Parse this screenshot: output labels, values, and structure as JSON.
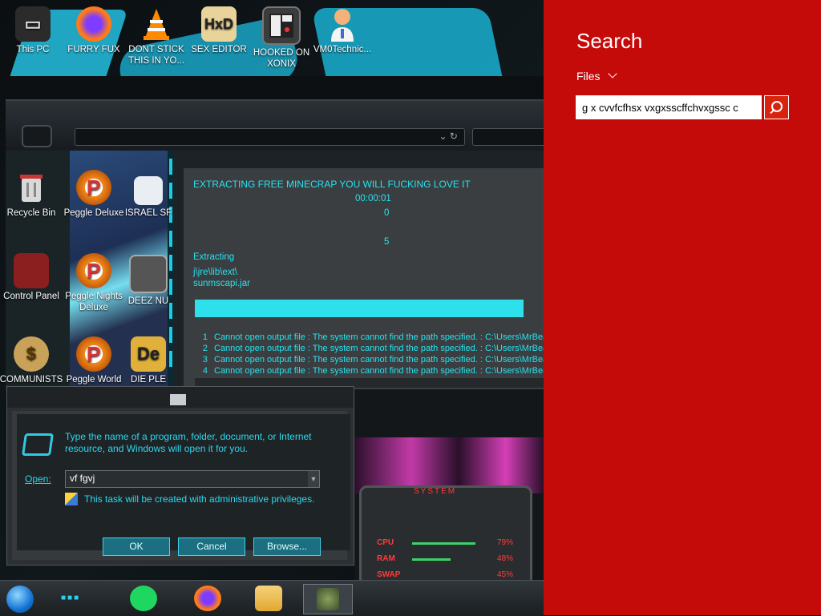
{
  "desktop_top_icons": [
    {
      "label": "This PC",
      "icon": "computer-icon",
      "color": "#444"
    },
    {
      "label": "FURRY FUX",
      "icon": "firefox-icon",
      "color": "#ff7a1a"
    },
    {
      "label": "DONT STICK THIS IN YO...",
      "icon": "vlc-cone-icon",
      "color": "#ff8a00"
    },
    {
      "label": "SEX EDITOR",
      "icon": "hxd-icon",
      "color": "#e8d39a"
    },
    {
      "label": "HOOKED ON XONIX",
      "icon": "xonix-icon",
      "color": "#3c3c3c"
    },
    {
      "label": "VM0Technic...",
      "icon": "doctor-icon",
      "color": "#f0f0f0"
    }
  ],
  "desktop_side_icons": [
    {
      "label": "Recycle Bin",
      "icon": "recycle-bin-icon",
      "color": "#cfcfcf"
    },
    {
      "label": "Peggle Deluxe",
      "icon": "peggle-icon",
      "color": "#f08a1a"
    },
    {
      "label": "ISRAEL SF",
      "icon": "israel-icon",
      "color": "#ddd"
    },
    {
      "label": "Control Panel",
      "icon": "control-panel-icon",
      "color": "#c44"
    },
    {
      "label": "Peggle Nights Deluxe",
      "icon": "peggle-icon",
      "color": "#f08a1a"
    },
    {
      "label": "DEEZ NU",
      "icon": "folder-stack-icon",
      "color": "#888"
    },
    {
      "label": "COMMUNISTS",
      "icon": "money-bag-icon",
      "color": "#c9a25a"
    },
    {
      "label": "Peggle World",
      "icon": "peggle-icon",
      "color": "#f08a1a"
    },
    {
      "label": "DIE PLE",
      "icon": "de-icon",
      "color": "#e0b03a"
    }
  ],
  "installer": {
    "heading": "EXTRACTING FREE MINECRAP YOU WILL FUCKING LOVE IT",
    "elapsed": "00:00:01",
    "count1": "0",
    "count2": "5",
    "status_label": "Extracting",
    "path_line1": "j\\jre\\lib\\ext\\",
    "path_line2": "sunmscapi.jar",
    "progress_fraction": 1.0,
    "log": [
      {
        "n": "1",
        "text": "Cannot open output file : The system cannot find the path specified. : C:\\Users\\MrBeast"
      },
      {
        "n": "2",
        "text": "Cannot open output file : The system cannot find the path specified. : C:\\Users\\MrBeast"
      },
      {
        "n": "3",
        "text": "Cannot open output file : The system cannot find the path specified. : C:\\Users\\MrBeast"
      },
      {
        "n": "4",
        "text": "Cannot open output file : The system cannot find the path specified. : C:\\Users\\MrBeast"
      }
    ]
  },
  "sysmon": {
    "title": "SYSTEM",
    "cpu_label": "CPU",
    "cpu_pct": "79%",
    "cpu_fraction": 0.79,
    "ram_label": "RAM",
    "ram_pct": "48%",
    "ram_fraction": 0.48,
    "third_label": "SWAP",
    "third_pct": "45%"
  },
  "run_dialog": {
    "description": "Type the name of a program, folder, document, or Internet resource, and Windows will open it for you.",
    "open_label": "Open:",
    "open_value": "vf fgvj",
    "admin_note": "This task will be created with administrative privileges.",
    "ok": "OK",
    "cancel": "Cancel",
    "browse": "Browse..."
  },
  "taskbar": {
    "items": [
      {
        "name": "start-orb"
      },
      {
        "name": "spotify-icon",
        "color": "#1ed760"
      },
      {
        "name": "firefox-icon",
        "color": "#ff7a1a"
      },
      {
        "name": "file-explorer-icon",
        "color": "#f2c14e"
      },
      {
        "name": "app-thumbnail-icon",
        "color": "#4d6b3a"
      }
    ]
  },
  "search_charm": {
    "title": "Search",
    "scope": "Files",
    "query": "g x cvvfcfhsx vxgxsscffchvxgssc c",
    "bg_color": "#c50a0a"
  }
}
